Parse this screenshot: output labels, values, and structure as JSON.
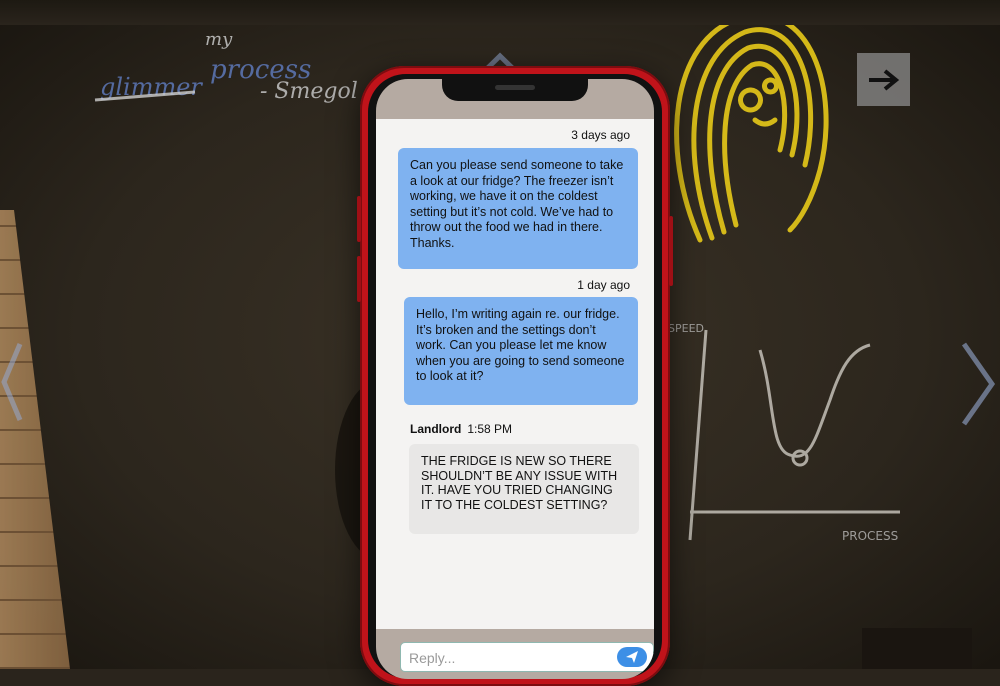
{
  "background": {
    "chalk_text": [
      "my",
      "glimmer",
      "process",
      "- Smegol"
    ],
    "chart_labels": [
      "SPEED",
      "PROCESS"
    ]
  },
  "navigation": {
    "next_icon": "arrow-right-icon",
    "up_icon": "chevron-up-icon",
    "down_icon": "chevron-down-icon",
    "left_icon": "chevron-left-icon",
    "right_icon": "chevron-right-icon"
  },
  "phone": {
    "color": "#c0131a",
    "messages": [
      {
        "timestamp": "3 days ago",
        "direction": "outgoing",
        "text": "Can you please send someone to take a look at our fridge? The freezer isn’t working, we have it on the coldest setting but it’s not cold. We’ve had to throw out the food we had in there. Thanks."
      },
      {
        "timestamp": "1 day ago",
        "direction": "outgoing",
        "text": "Hello, I’m writing again re. our fridge. It’s broken and the settings don’t work. Can you please let me know when you are going to send someone to look at it?"
      },
      {
        "sender": "Landlord",
        "time": "1:58 PM",
        "direction": "incoming",
        "text": "THE FRIDGE IS NEW SO THERE SHOULDN’T BE ANY ISSUE WITH IT. HAVE YOU TRIED CHANGING IT TO THE COLDEST SETTING?"
      }
    ],
    "reply": {
      "placeholder": "Reply...",
      "send_icon": "send-icon"
    },
    "colors": {
      "outgoing_bubble": "#7fb2f0",
      "incoming_bubble": "#e8e7e6",
      "send_button": "#3d8fe6"
    }
  }
}
